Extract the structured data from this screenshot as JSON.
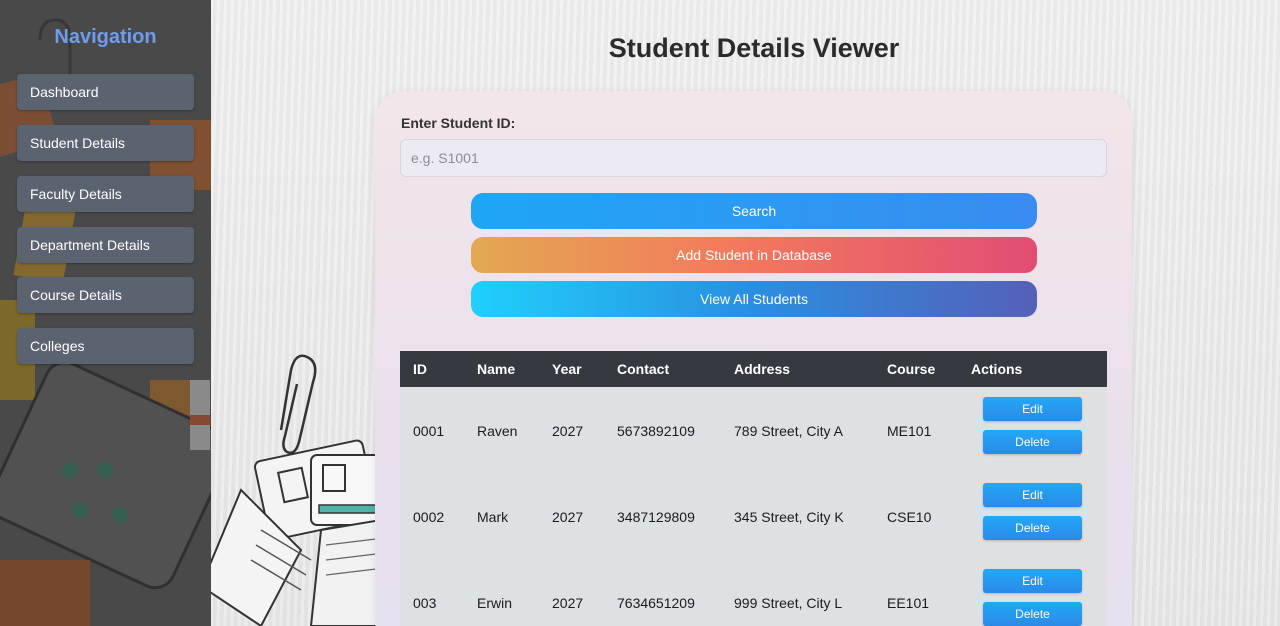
{
  "sidebar": {
    "title": "Navigation",
    "items": [
      {
        "label": "Dashboard"
      },
      {
        "label": "Student Details"
      },
      {
        "label": "Faculty Details"
      },
      {
        "label": "Department Details"
      },
      {
        "label": "Course Details"
      },
      {
        "label": "Colleges"
      }
    ]
  },
  "main": {
    "title": "Student Details Viewer",
    "id_label": "Enter Student ID:",
    "id_placeholder": "e.g. S1001",
    "id_value": "",
    "search_label": "Search",
    "add_label": "Add Student in Database",
    "view_all_label": "View All Students"
  },
  "table": {
    "headers": {
      "id": "ID",
      "name": "Name",
      "year": "Year",
      "contact": "Contact",
      "address": "Address",
      "course": "Course",
      "actions": "Actions"
    },
    "edit_label": "Edit",
    "delete_label": "Delete",
    "rows": [
      {
        "id": "0001",
        "name": "Raven",
        "year": "2027",
        "contact": "5673892109",
        "address": "789 Street, City A",
        "course": "ME101"
      },
      {
        "id": "0002",
        "name": "Mark",
        "year": "2027",
        "contact": "3487129809",
        "address": "345 Street, City K",
        "course": "CSE10"
      },
      {
        "id": "003",
        "name": "Erwin",
        "year": "2027",
        "contact": "7634651209",
        "address": "999 Street, City L",
        "course": "EE101"
      }
    ]
  },
  "colors": {
    "accent": "#6f9cf0",
    "table_header": "#353a40",
    "action_button": "#2b8ae8"
  }
}
